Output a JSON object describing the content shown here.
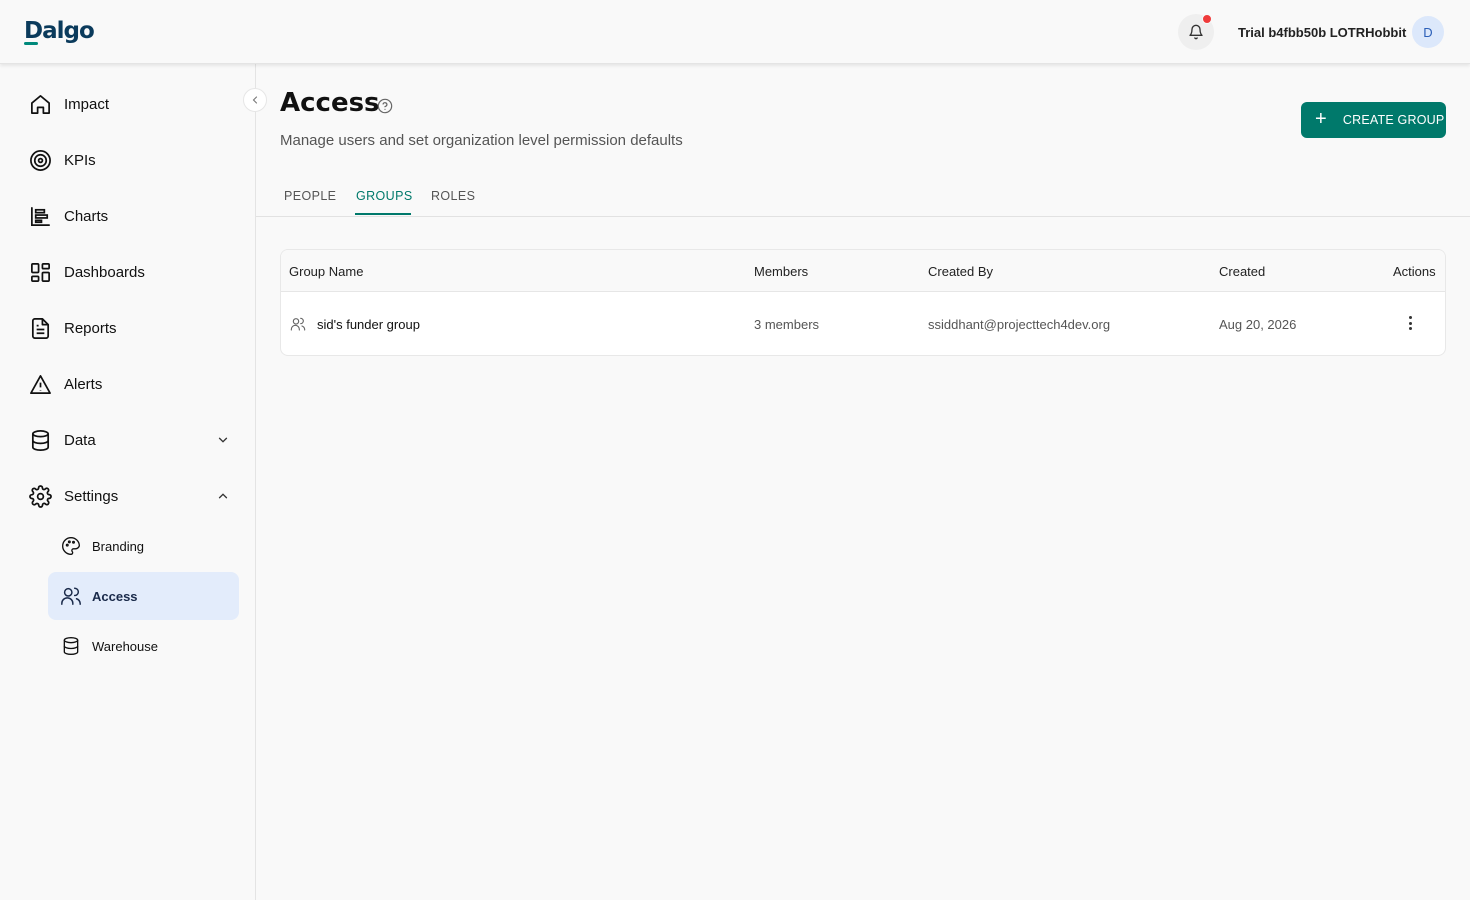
{
  "app": {
    "logo_text": "Dalgo",
    "org_name": "Trial b4fbb50b LOTRHobbit",
    "avatar_initial": "D",
    "accent_color": "#00796b"
  },
  "sidebar": {
    "items": [
      {
        "label": "Impact",
        "icon": "home-icon"
      },
      {
        "label": "KPIs",
        "icon": "target-icon"
      },
      {
        "label": "Charts",
        "icon": "chart-icon"
      },
      {
        "label": "Dashboards",
        "icon": "dashboard-icon"
      },
      {
        "label": "Reports",
        "icon": "report-icon"
      },
      {
        "label": "Alerts",
        "icon": "alert-icon"
      },
      {
        "label": "Data",
        "icon": "database-icon",
        "expanded": false
      },
      {
        "label": "Settings",
        "icon": "gear-icon",
        "expanded": true
      }
    ],
    "settings_children": [
      {
        "label": "Branding",
        "icon": "palette-icon"
      },
      {
        "label": "Access",
        "icon": "users-icon",
        "active": true
      },
      {
        "label": "Warehouse",
        "icon": "database-icon"
      }
    ]
  },
  "page": {
    "title": "Access",
    "subtitle": "Manage users and set organization level permission defaults",
    "create_button": "CREATE GROUP"
  },
  "tabs": [
    {
      "label": "PEOPLE",
      "active": false
    },
    {
      "label": "GROUPS",
      "active": true
    },
    {
      "label": "ROLES",
      "active": false
    }
  ],
  "table": {
    "columns": [
      "Group Name",
      "Members",
      "Created By",
      "Created",
      "Actions"
    ],
    "rows": [
      {
        "group_name": "sid's funder group",
        "members": "3 members",
        "created_by": "ssiddhant@projecttech4dev.org",
        "created": "Aug 20, 2026"
      }
    ]
  }
}
